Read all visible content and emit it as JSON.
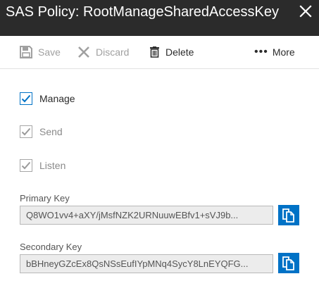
{
  "header": {
    "title": "SAS Policy: RootManageSharedAccessKey"
  },
  "toolbar": {
    "save_label": "Save",
    "discard_label": "Discard",
    "delete_label": "Delete",
    "more_label": "More"
  },
  "claims": [
    {
      "label": "Manage",
      "checked": true,
      "enabled": true
    },
    {
      "label": "Send",
      "checked": true,
      "enabled": false
    },
    {
      "label": "Listen",
      "checked": true,
      "enabled": false
    }
  ],
  "keys": {
    "primary_label": "Primary Key",
    "primary_value": "Q8WO1vv4+aXY/jMsfNZK2URNuuwEBfv1+sVJ9b...",
    "secondary_label": "Secondary Key",
    "secondary_value": "bBHneyGZcEx8QsNSsEufIYpMNq4SycY8LnEYQFG..."
  },
  "colors": {
    "header_bg": "#2b2b2b",
    "accent": "#0072c6",
    "disabled_text": "#a0a0a0"
  },
  "icons": [
    "close-icon",
    "save-icon",
    "discard-icon",
    "trash-icon",
    "more-icon",
    "checkmark-icon",
    "copy-icon"
  ]
}
